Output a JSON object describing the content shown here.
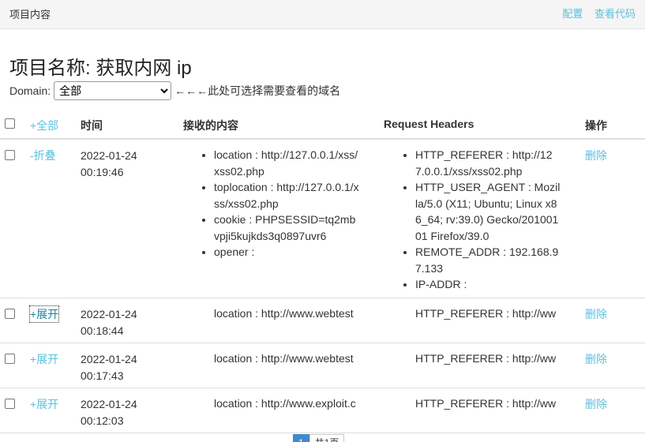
{
  "topbar": {
    "title": "项目内容",
    "links": [
      "配置",
      "查看代码"
    ]
  },
  "project_title": "项目名称: 获取内网 ip",
  "domain": {
    "label": "Domain:",
    "selected": "全部",
    "hint": "←←←此处可选择需要查看的域名"
  },
  "table": {
    "headers": {
      "select_all": "+全部",
      "time": "时间",
      "content": "接收的内容",
      "request_headers": "Request Headers",
      "operation": "操作"
    },
    "rows": [
      {
        "toggle": "-折叠",
        "time_date": "2022-01-24",
        "time_clock": "00:19:46",
        "content": [
          "location : http://127.0.0.1/xss/xss02.php",
          "toplocation : http://127.0.0.1/xss/xss02.php",
          "cookie : PHPSESSID=tq2mbvpji5kujkds3q0897uvr6",
          "opener :"
        ],
        "headers": [
          "HTTP_REFERER : http://127.0.0.1/xss/xss02.php",
          "HTTP_USER_AGENT : Mozilla/5.0 (X11; Ubuntu; Linux x86_64; rv:39.0) Gecko/20100101 Firefox/39.0",
          "REMOTE_ADDR : 192.168.97.133",
          "IP-ADDR :"
        ],
        "delete": "删除"
      },
      {
        "toggle": "+展开",
        "time_date": "2022-01-24",
        "time_clock": "00:18:44",
        "content": [
          "location : http://www.webtest"
        ],
        "headers": [
          "HTTP_REFERER : http://ww"
        ],
        "delete": "删除"
      },
      {
        "toggle": "+展开",
        "time_date": "2022-01-24",
        "time_clock": "00:17:43",
        "content": [
          "location : http://www.webtest"
        ],
        "headers": [
          "HTTP_REFERER : http://ww"
        ],
        "delete": "删除"
      },
      {
        "toggle": "+展开",
        "time_date": "2022-01-24",
        "time_clock": "00:12:03",
        "content": [
          "location : http://www.exploit.c"
        ],
        "headers": [
          "HTTP_REFERER : http://ww"
        ],
        "delete": "删除"
      }
    ]
  },
  "pagination": {
    "current": "1",
    "total": "共1页"
  }
}
